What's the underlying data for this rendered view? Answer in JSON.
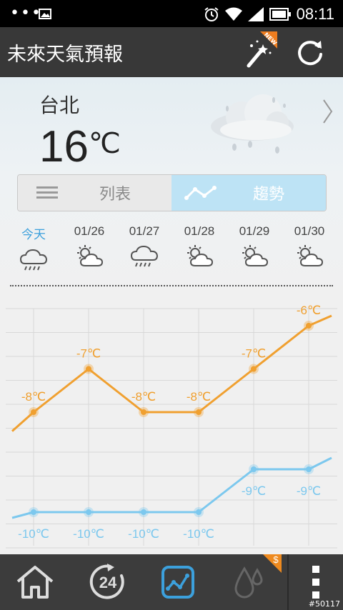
{
  "status_bar": {
    "time": "08:11",
    "dots": "•••"
  },
  "app_bar": {
    "title": "未來天氣預報",
    "new_badge": "NEW"
  },
  "current": {
    "city": "台北",
    "temperature": "16",
    "unit": "℃"
  },
  "view_toggle": {
    "list_label": "列表",
    "trend_label": "趨勢",
    "selected": "trend"
  },
  "days": [
    {
      "label": "今天",
      "icon": "cloud-rain-icon",
      "today": true
    },
    {
      "label": "01/26",
      "icon": "partly-sunny-icon"
    },
    {
      "label": "01/27",
      "icon": "cloud-rain-icon"
    },
    {
      "label": "01/28",
      "icon": "partly-sunny-icon"
    },
    {
      "label": "01/29",
      "icon": "partly-sunny-icon"
    },
    {
      "label": "01/30",
      "icon": "partly-sunny-icon"
    }
  ],
  "chart_data": {
    "type": "line",
    "categories": [
      "今天",
      "01/26",
      "01/27",
      "01/28",
      "01/29",
      "01/30"
    ],
    "series": [
      {
        "values": [
          -8,
          -7,
          -8,
          -8,
          -7,
          -6
        ],
        "labels": [
          "-8℃",
          "-7℃",
          "-8℃",
          "-8℃",
          "-7℃",
          "-6℃"
        ],
        "color": "#f0a030"
      },
      {
        "values": [
          -10,
          -10,
          -10,
          -10,
          -9,
          -9
        ],
        "labels": [
          "-10℃",
          "-10℃",
          "-10℃",
          "-10℃",
          "-9℃",
          "-9℃"
        ],
        "color": "#7cc8ee"
      }
    ],
    "grid": true
  },
  "nav": {
    "items": [
      {
        "icon": "home-icon"
      },
      {
        "icon": "hours-24-icon",
        "text": "24"
      },
      {
        "icon": "trend-chart-icon",
        "active": true
      },
      {
        "icon": "raindrops-icon"
      },
      {
        "icon": "more-vertical-icon"
      }
    ],
    "badge": "$"
  },
  "watermark": "#50117",
  "colors": {
    "accent": "#3ca0dc",
    "high": "#f0a030",
    "low": "#7cc8ee",
    "appbar": "#383838"
  }
}
